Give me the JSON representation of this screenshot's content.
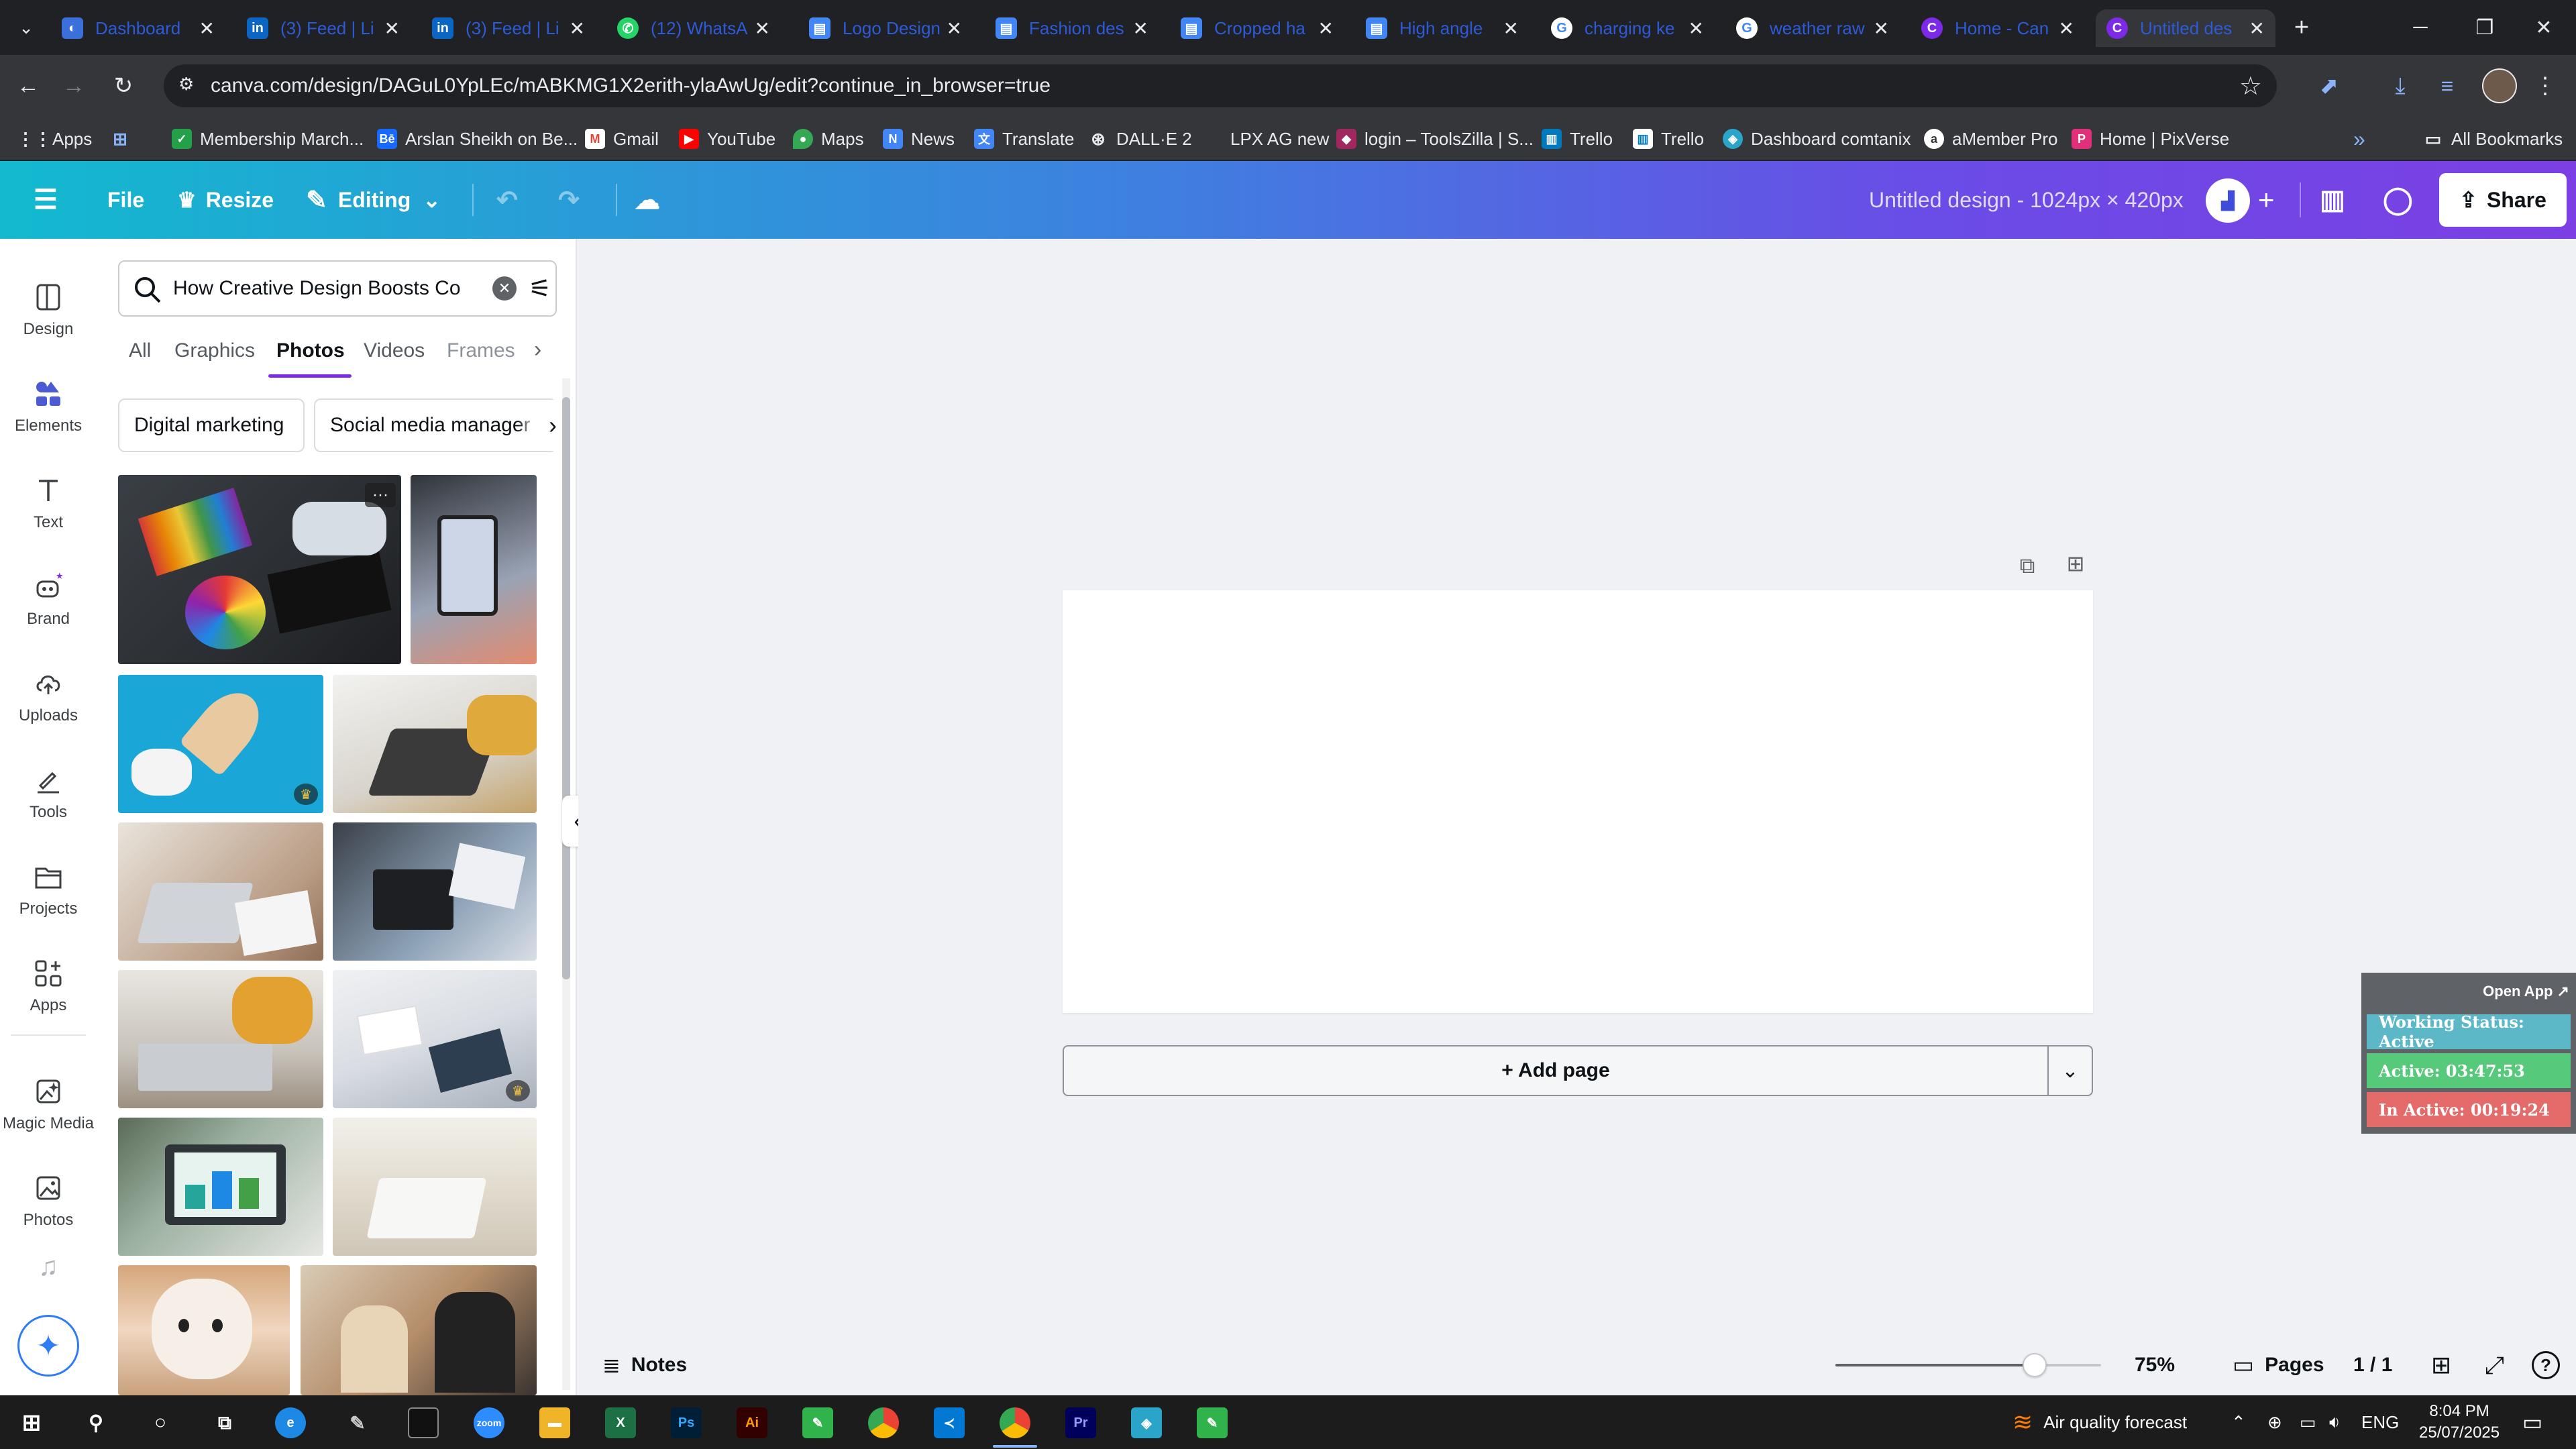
{
  "browser": {
    "tabs": [
      {
        "title": "Dashboard",
        "icon": "dashboard-favicon",
        "active": false
      },
      {
        "title": "(3) Feed | Li",
        "icon": "linkedin-favicon",
        "active": false
      },
      {
        "title": "(3) Feed | Li",
        "icon": "linkedin-favicon",
        "active": false
      },
      {
        "title": "(12) WhatsA",
        "icon": "whatsapp-favicon",
        "active": false
      },
      {
        "title": "Logo Design",
        "icon": "doc-favicon",
        "active": false
      },
      {
        "title": "Fashion des",
        "icon": "doc-favicon",
        "active": false
      },
      {
        "title": "Cropped ha",
        "icon": "doc-favicon",
        "active": false
      },
      {
        "title": "High angle",
        "icon": "doc-favicon",
        "active": false
      },
      {
        "title": "charging ke",
        "icon": "google-favicon",
        "active": false
      },
      {
        "title": "weather raw",
        "icon": "google-favicon",
        "active": false
      },
      {
        "title": "Home - Can",
        "icon": "canva-favicon",
        "active": false
      },
      {
        "title": "Untitled des",
        "icon": "canva-favicon",
        "active": true
      }
    ],
    "url": "canva.com/design/DAGuL0YpLEc/mABKMG1X2erith-ylaAwUg/edit?continue_in_browser=true",
    "bookmarks": [
      {
        "label": "Apps",
        "icon": "apps-grid-icon"
      },
      {
        "label": "Membership March...",
        "icon": "bookmark-icon"
      },
      {
        "label": "Arslan Sheikh on Be...",
        "icon": "behance-icon"
      },
      {
        "label": "Gmail",
        "icon": "gmail-icon"
      },
      {
        "label": "YouTube",
        "icon": "youtube-icon"
      },
      {
        "label": "Maps",
        "icon": "maps-icon"
      },
      {
        "label": "News",
        "icon": "news-icon"
      },
      {
        "label": "Translate",
        "icon": "translate-icon"
      },
      {
        "label": "DALL·E 2",
        "icon": "openai-icon"
      },
      {
        "label": "LPX AG new",
        "icon": "bookmark-icon"
      },
      {
        "label": "login – ToolsZilla | S...",
        "icon": "toolszilla-icon"
      },
      {
        "label": "Trello",
        "icon": "trello-icon"
      },
      {
        "label": "Trello",
        "icon": "trello-icon"
      },
      {
        "label": "Dashboard comtanix",
        "icon": "comtanix-icon"
      },
      {
        "label": "aMember Pro",
        "icon": "amember-icon"
      },
      {
        "label": "Home | PixVerse",
        "icon": "pixverse-icon"
      }
    ],
    "all_bookmarks": "All Bookmarks"
  },
  "canva": {
    "header": {
      "file": "File",
      "resize": "Resize",
      "mode": "Editing",
      "doc_title": "Untitled design - 1024px × 420px",
      "share": "Share"
    },
    "rail": [
      {
        "label": "Design",
        "icon": "design-icon"
      },
      {
        "label": "Elements",
        "icon": "elements-icon"
      },
      {
        "label": "Text",
        "icon": "text-icon"
      },
      {
        "label": "Brand",
        "icon": "brand-icon"
      },
      {
        "label": "Uploads",
        "icon": "uploads-icon"
      },
      {
        "label": "Tools",
        "icon": "tools-icon"
      },
      {
        "label": "Projects",
        "icon": "projects-icon"
      },
      {
        "label": "Apps",
        "icon": "apps-icon"
      },
      {
        "label": "Magic Media",
        "icon": "magic-media-icon"
      },
      {
        "label": "Photos",
        "icon": "photos-icon"
      }
    ],
    "panel": {
      "search_value": "How Creative Design Boosts Co",
      "tabs": [
        "All",
        "Graphics",
        "Photos",
        "Videos",
        "Frames"
      ],
      "active_tab": "Photos",
      "chips": [
        "Digital marketing",
        "Social media manager"
      ]
    },
    "canvas": {
      "add_page": "+ Add page"
    },
    "footer": {
      "notes": "Notes",
      "zoom_value": 0.75,
      "zoom": "75%",
      "pages": "Pages",
      "page_count": "1 / 1"
    }
  },
  "tracker": {
    "open_app": "Open App ↗",
    "status": "Working Status: Active",
    "active": "Active: 03:47:53",
    "inactive": "In Active: 00:19:24"
  },
  "taskbar": {
    "weather": "Air quality forecast",
    "lang": "ENG",
    "time": "8:04 PM",
    "date": "25/07/2025"
  },
  "colors": {
    "accent": "#7d2ae8",
    "status_active": "#5cb8c7",
    "active_green": "#57c97a",
    "inactive_red": "#e56a6a"
  }
}
